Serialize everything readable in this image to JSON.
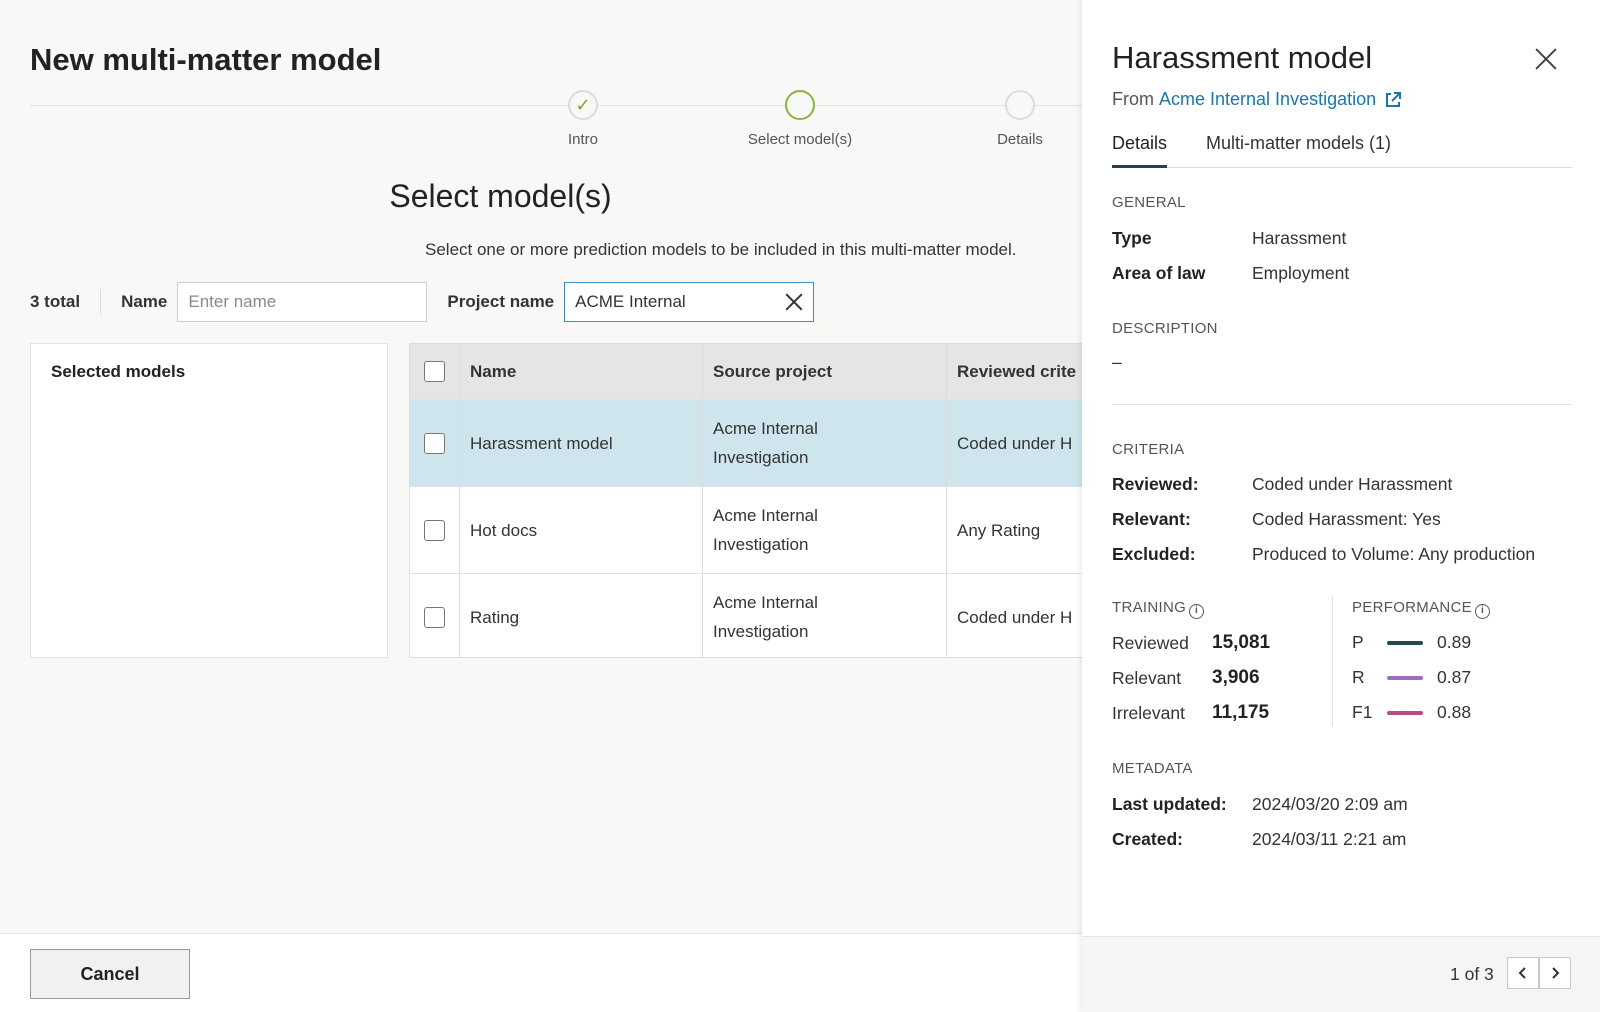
{
  "page": {
    "title": "New multi-matter model"
  },
  "stepper": {
    "steps": [
      {
        "label": "Intro",
        "state": "done",
        "icon": "check-icon"
      },
      {
        "label": "Select model(s)",
        "state": "current"
      },
      {
        "label": "Details",
        "state": "upcoming"
      }
    ]
  },
  "section": {
    "title": "Select model(s)",
    "subtitle": "Select one or more prediction models to be included in this multi-matter model."
  },
  "filters": {
    "total": "3 total",
    "name_label": "Name",
    "name_placeholder": "Enter name",
    "project_label": "Project name",
    "project_value": "ACME Internal"
  },
  "selected_models": {
    "heading": "Selected models"
  },
  "table": {
    "columns": [
      "Name",
      "Source project",
      "Reviewed crite"
    ],
    "rows": [
      {
        "name": "Harassment model",
        "source_line1": "Acme Internal",
        "source_line2": "Investigation",
        "reviewed": "Coded under H",
        "selected": true
      },
      {
        "name": "Hot docs",
        "source_line1": "Acme Internal",
        "source_line2": "Investigation",
        "reviewed": "Any Rating",
        "selected": false
      },
      {
        "name": "Rating",
        "source_line1": "Acme Internal",
        "source_line2": "Investigation",
        "reviewed": "Coded under H",
        "selected": false
      }
    ]
  },
  "footer": {
    "cancel_label": "Cancel"
  },
  "panel": {
    "title": "Harassment model",
    "from_label": "From",
    "from_link": "Acme Internal Investigation",
    "tabs": [
      "Details",
      "Multi-matter models (1)"
    ],
    "general": {
      "heading": "GENERAL",
      "type_label": "Type",
      "type_value": "Harassment",
      "area_label": "Area of law",
      "area_value": "Employment"
    },
    "description": {
      "heading": "DESCRIPTION",
      "value": "–"
    },
    "criteria": {
      "heading": "CRITERIA",
      "reviewed_label": "Reviewed:",
      "reviewed_value": "Coded under Harassment",
      "relevant_label": "Relevant:",
      "relevant_value": "Coded Harassment: Yes",
      "excluded_label": "Excluded:",
      "excluded_value": "Produced to Volume: Any production"
    },
    "training": {
      "heading": "TRAINING",
      "rows": [
        {
          "label": "Reviewed",
          "value": "15,081"
        },
        {
          "label": "Relevant",
          "value": "3,906"
        },
        {
          "label": "Irrelevant",
          "value": "11,175"
        }
      ]
    },
    "performance": {
      "heading": "PERFORMANCE",
      "rows": [
        {
          "label": "P",
          "value": "0.89",
          "color": "#1e4a52"
        },
        {
          "label": "R",
          "value": "0.87",
          "color": "#9a6fc0"
        },
        {
          "label": "F1",
          "value": "0.88",
          "color": "#b84a84"
        }
      ]
    },
    "metadata": {
      "heading": "METADATA",
      "updated_label": "Last updated:",
      "updated_value": "2024/03/20 2:09 am",
      "created_label": "Created:",
      "created_value": "2024/03/11 2:21 am"
    },
    "pager": {
      "text": "1 of 3"
    }
  },
  "colors": {
    "accent_link": "#1a77a8",
    "selected_row": "#cfe5ee",
    "step_done": "#7aa526"
  }
}
